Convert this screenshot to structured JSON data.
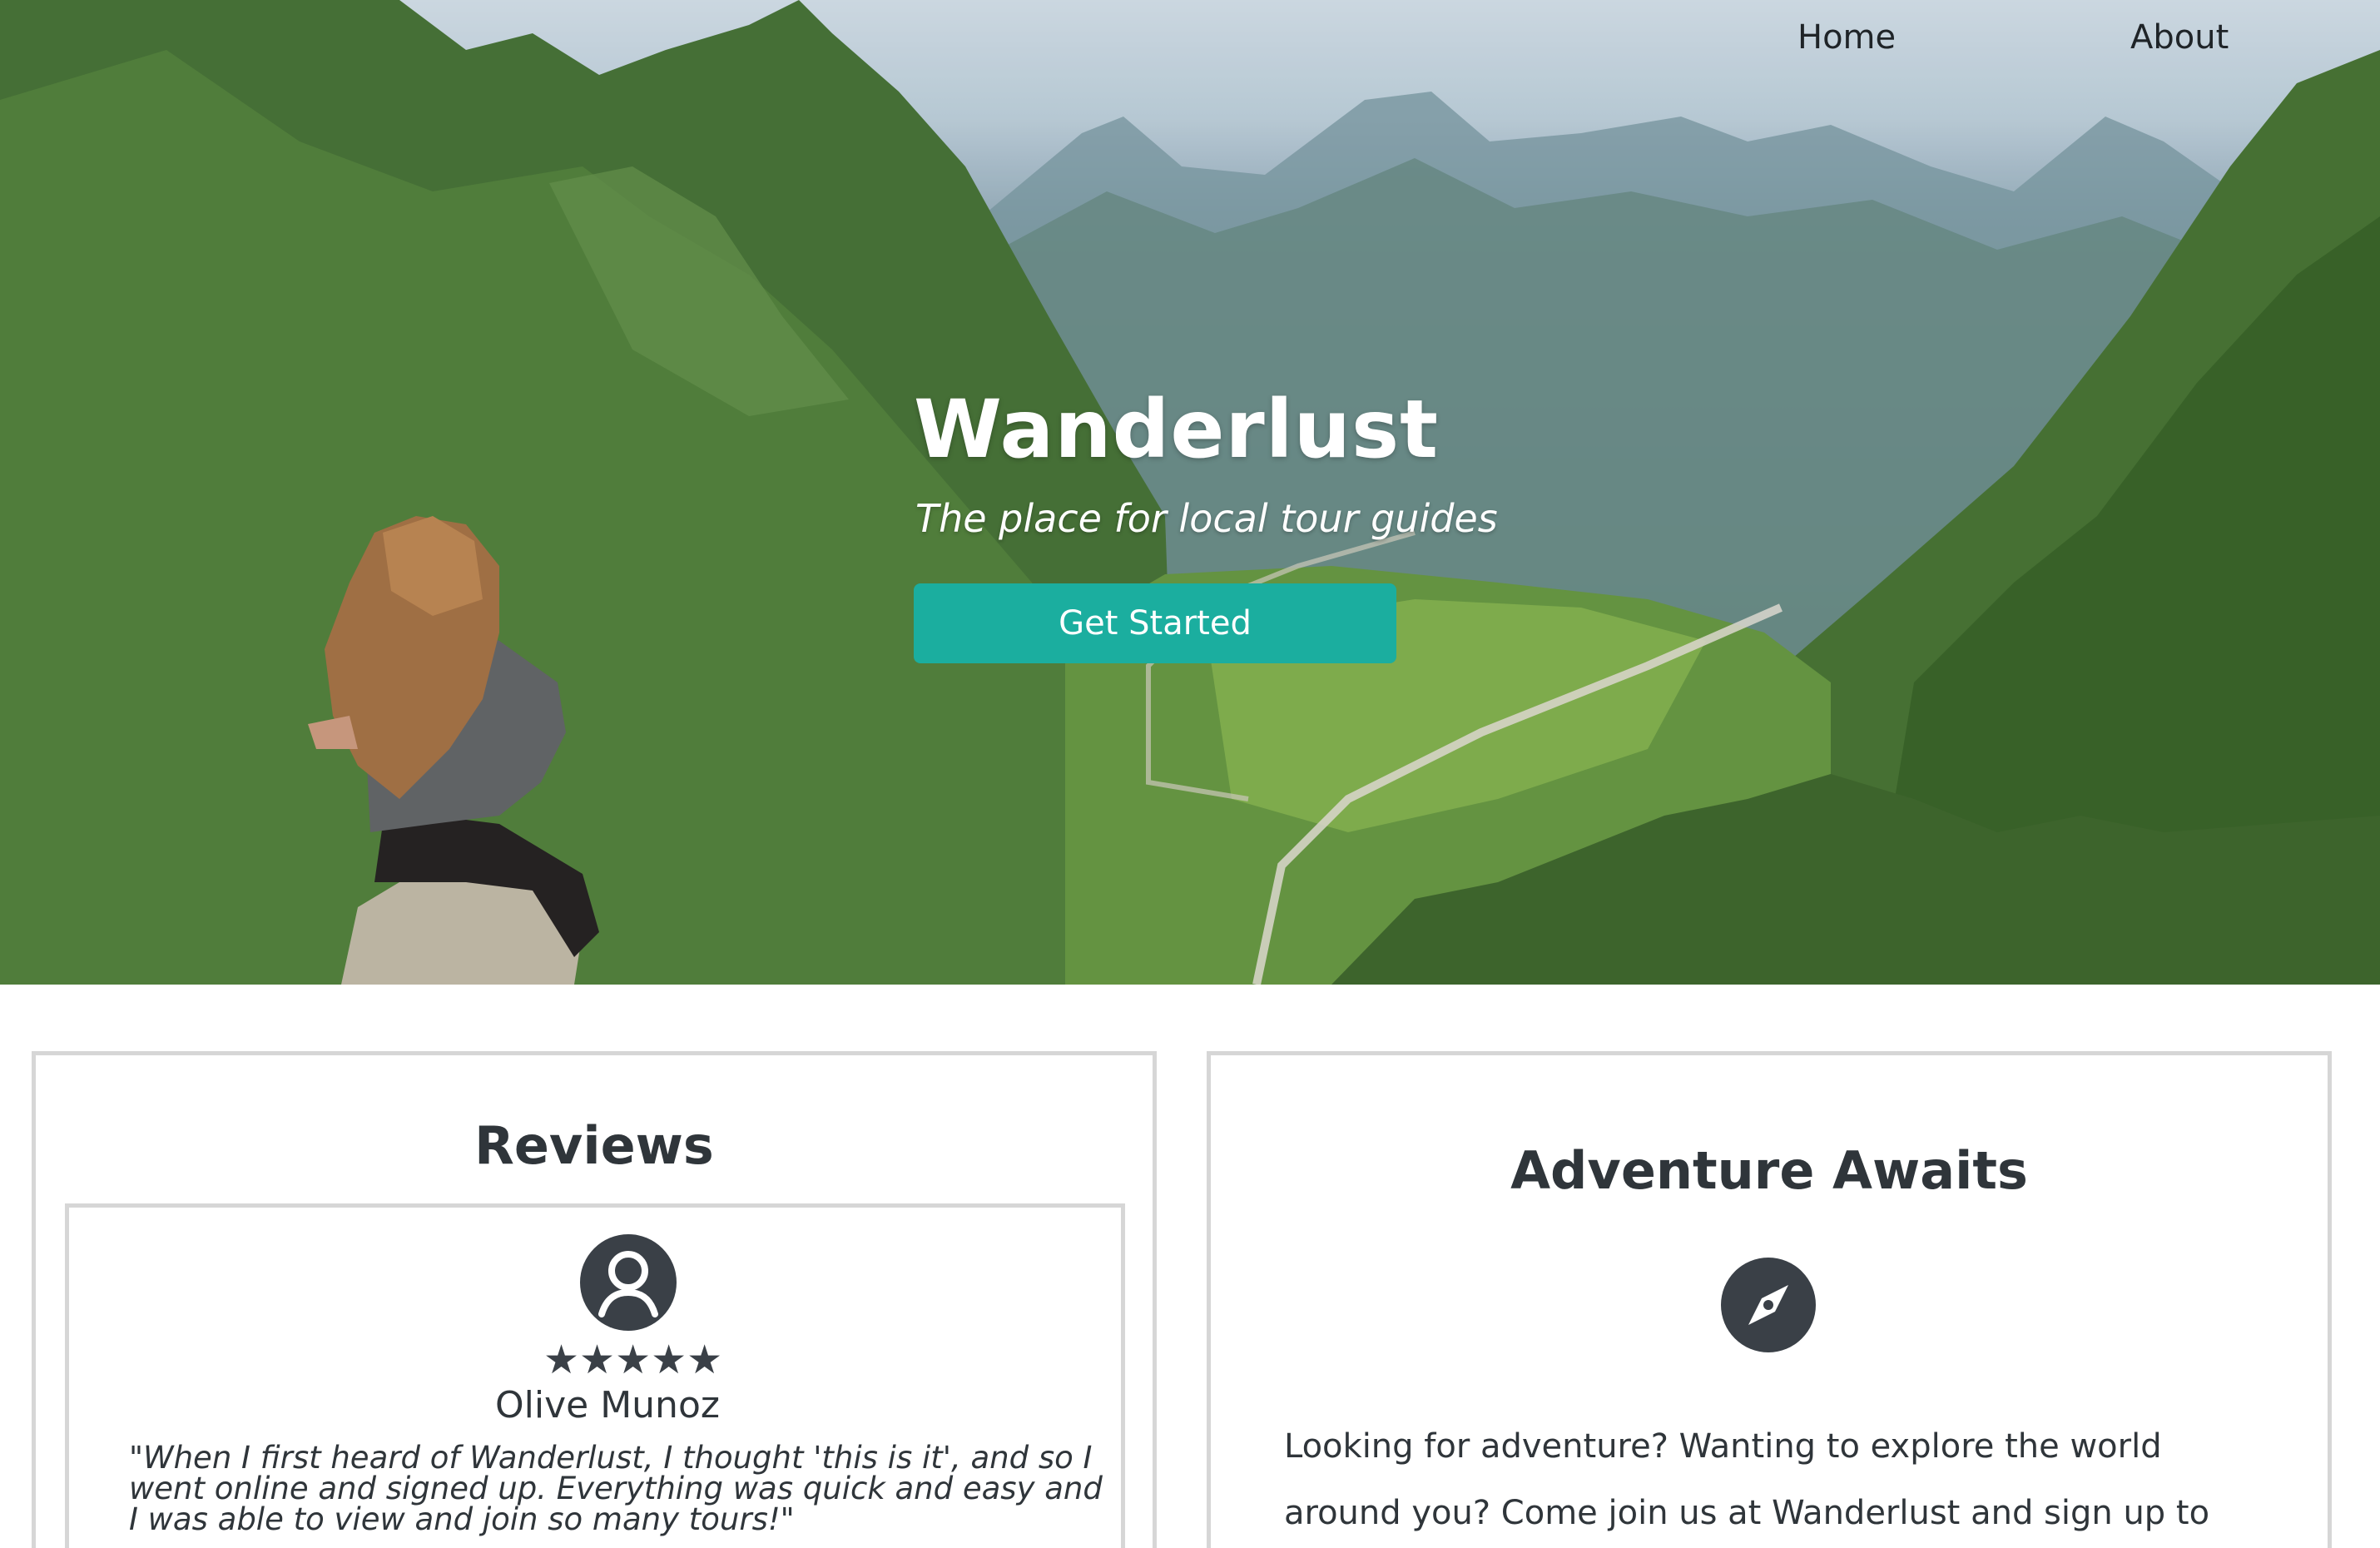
{
  "nav": {
    "home_label": "Home",
    "about_label": "About"
  },
  "hero": {
    "title": "Wanderlust",
    "subtitle": "The place for local tour guides",
    "cta_label": "Get Started",
    "cta_color": "#1bae9f"
  },
  "reviews": {
    "title": "Reviews",
    "items": [
      {
        "avatar_icon": "user-circle-icon",
        "rating": 5,
        "max_rating": 5,
        "stars": "★★★★★",
        "name": "Olive Munoz",
        "quote": "\"When I first heard of Wanderlust, I thought 'this is it', and so I went online and signed up. Everything was quick and easy and I was able to view and join so many tours!\""
      }
    ]
  },
  "adventure": {
    "title": "Adventure Awaits",
    "icon": "compass-icon",
    "text": "Looking for adventure? Wanting to explore the world around you? Come join us at Wanderlust and sign up to view tours at"
  }
}
